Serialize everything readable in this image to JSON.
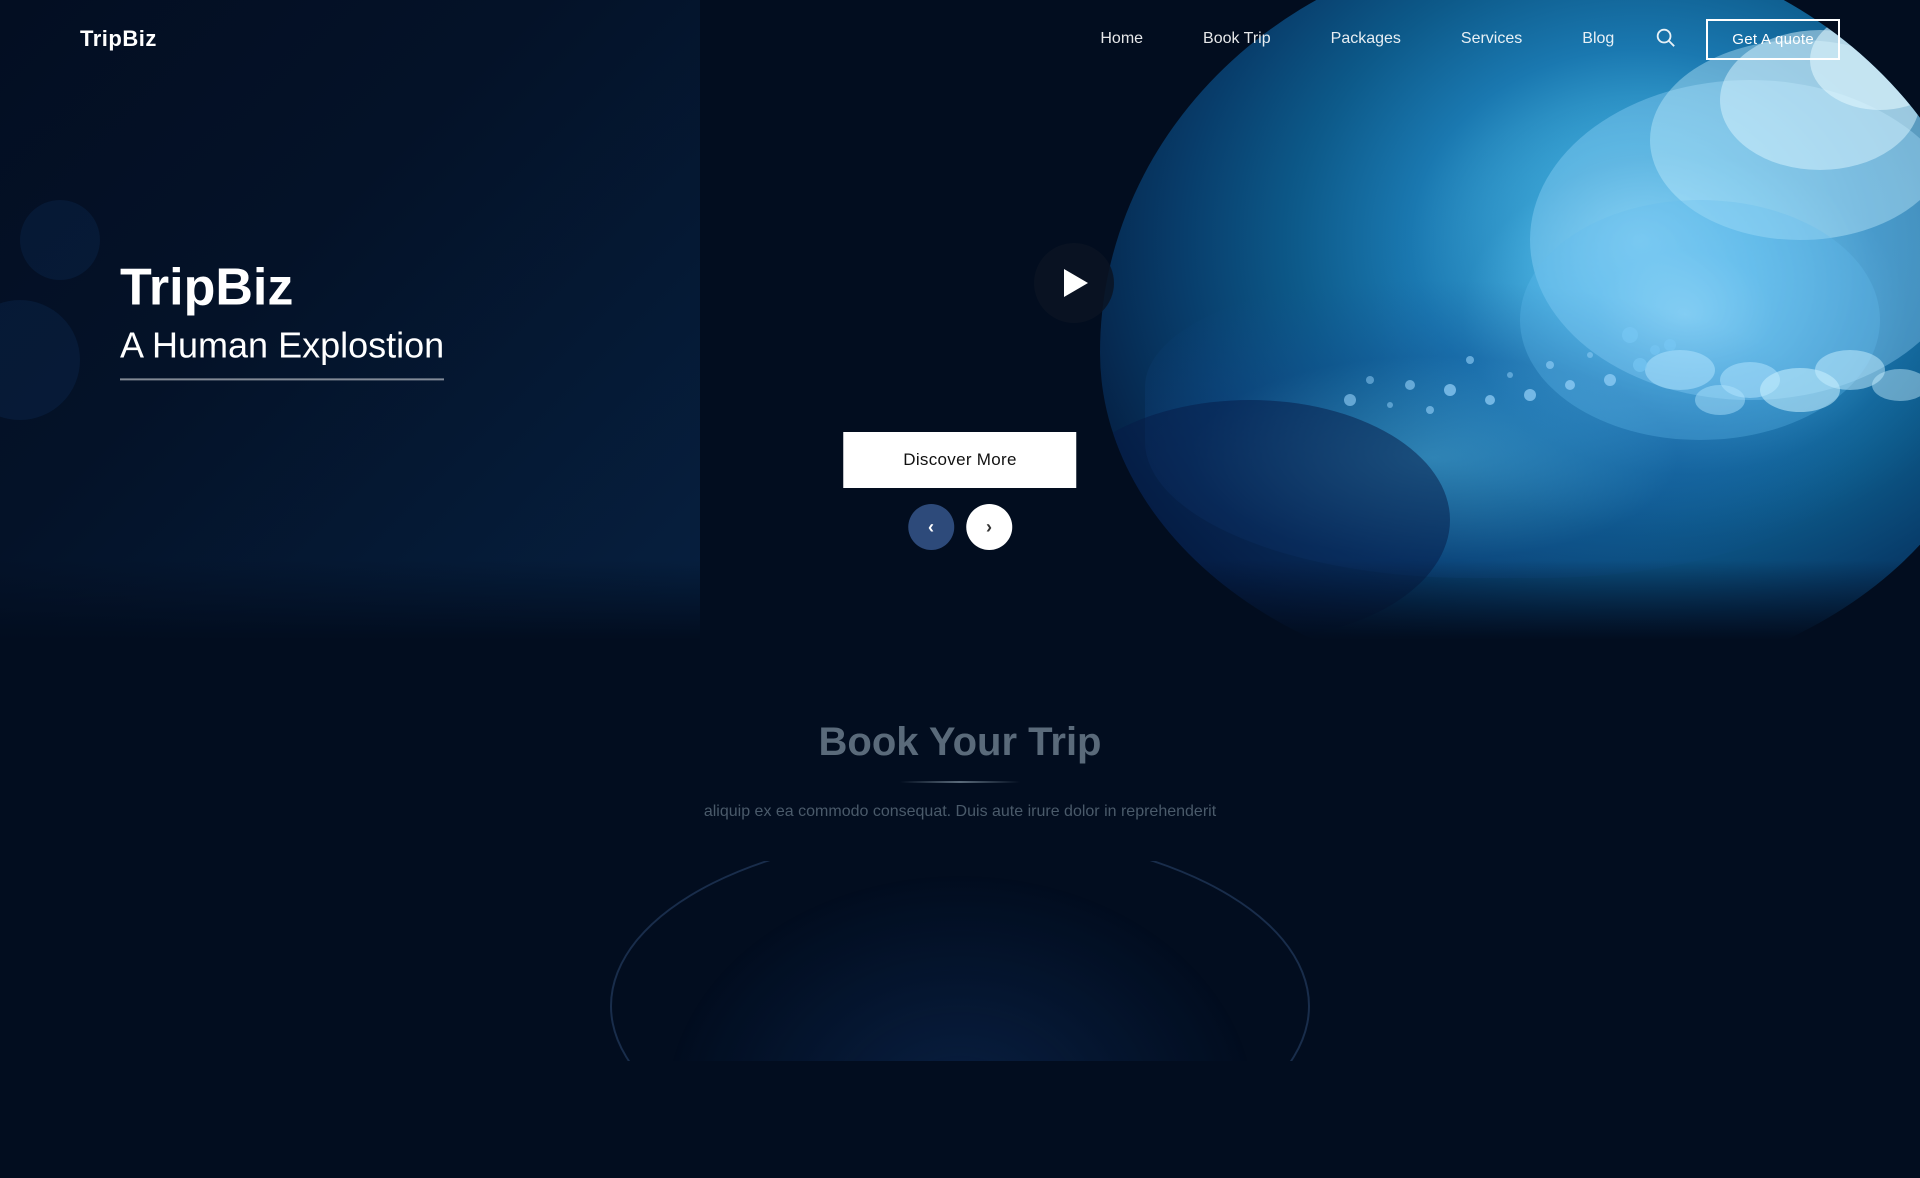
{
  "brand": {
    "logo": "TripBiz"
  },
  "nav": {
    "links": [
      {
        "id": "home",
        "label": "Home"
      },
      {
        "id": "book-trip",
        "label": "Book Trip"
      },
      {
        "id": "packages",
        "label": "Packages"
      },
      {
        "id": "services",
        "label": "Services"
      },
      {
        "id": "blog",
        "label": "Blog"
      }
    ],
    "quote_btn": "Get A quote"
  },
  "hero": {
    "title": "TripBiz",
    "subtitle": "A Human Explostion",
    "discover_btn": "Discover More"
  },
  "book_section": {
    "title": "Book Your Trip",
    "subtitle": "aliquip ex ea commodo consequat. Duis aute irure dolor in reprehenderit"
  }
}
